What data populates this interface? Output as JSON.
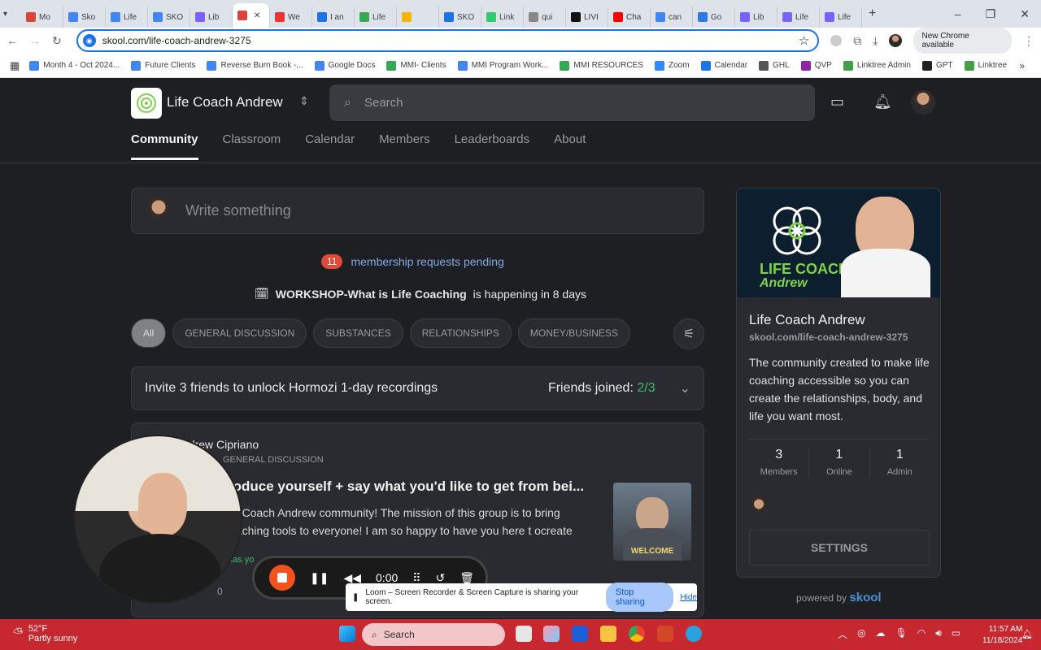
{
  "browser": {
    "tabs": [
      "Mo",
      "Sko",
      "Life",
      "SKO",
      "Lib",
      "",
      "We",
      "I an",
      "Life",
      "",
      "SKO",
      "Link",
      "qui",
      "LIVI",
      "Cha",
      "can",
      "Go",
      "Lib",
      "Life",
      "Life"
    ],
    "url": "skool.com/life-coach-andrew-3275",
    "new_chrome": "New Chrome available",
    "bookmarks": [
      "Month 4 - Oct 2024...",
      "Future Clients",
      "Reverse Burn Book -...",
      "Google Docs",
      "MMI- Clients",
      "MMI Program Work...",
      "MMI RESOURCES",
      "Zoom",
      "Calendar",
      "GHL",
      "QVP",
      "Linktree Admin",
      "GPT",
      "Linktree"
    ]
  },
  "group": {
    "name": "Life Coach Andrew",
    "search_placeholder": "Search"
  },
  "nav": [
    "Community",
    "Classroom",
    "Calendar",
    "Members",
    "Leaderboards",
    "About"
  ],
  "composer": {
    "placeholder": "Write something"
  },
  "pending": {
    "count": "11",
    "text": "membership requests pending"
  },
  "event": {
    "title": "WORKSHOP-What is Life Coaching",
    "suffix": "is happening in 8 days"
  },
  "filters": [
    "All",
    "GENERAL DISCUSSION",
    "SUBSTANCES",
    "RELATIONSHIPS",
    "MONEY/BUSINESS"
  ],
  "invite": {
    "text": "Invite 3 friends to unlock Hormozi 1-day recordings",
    "label": "Friends joined:",
    "count": "2/3"
  },
  "post": {
    "author": "ndrew Cipriano",
    "category": "GENERAL DISCUSSION",
    "title": "roduce yourself + say what you'd like to get from bei...",
    "body": "fe Coach Andrew community! The mission of this group is to bring oaching tools to everyone! I am so happy to have you here t ocreate",
    "thumb_label": "WELCOME",
    "comments": "0",
    "partial_status": "has yo"
  },
  "sidebar": {
    "banner_text_1": "LIFE COACH",
    "banner_text_2": "Andrew",
    "name": "Life Coach Andrew",
    "url": "skool.com/life-coach-andrew-3275",
    "description": "The community created to make life coaching accessible so you can create the relationships, body, and life you want most.",
    "stats": [
      {
        "n": "3",
        "l": "Members"
      },
      {
        "n": "1",
        "l": "Online"
      },
      {
        "n": "1",
        "l": "Admin"
      }
    ],
    "settings": "SETTINGS"
  },
  "powered": {
    "prefix": "powered by",
    "brand": "skool"
  },
  "loom": {
    "time": "0:00",
    "message": "Loom – Screen Recorder & Screen Capture is sharing your screen.",
    "stop": "Stop sharing",
    "hide": "Hide"
  },
  "taskbar": {
    "temp": "52°F",
    "weather": "Partly sunny",
    "search": "Search",
    "time": "11:57 AM",
    "date": "11/18/2024"
  },
  "colors": {
    "accent": "#3dbb6e",
    "link": "#7fa8e8",
    "badge": "#e04a3a",
    "taskbar": "#c7282f"
  }
}
